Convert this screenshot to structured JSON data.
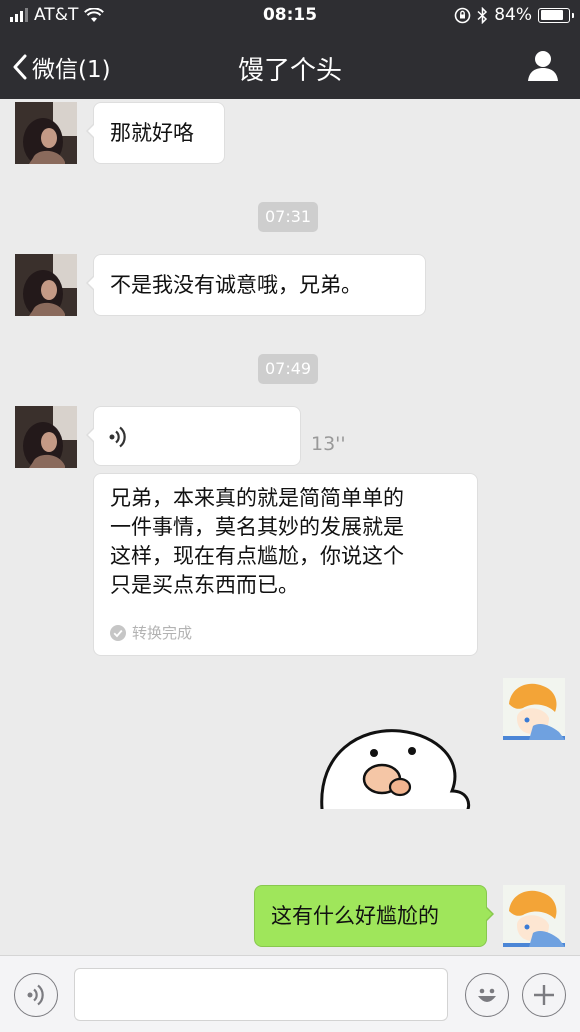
{
  "status_bar": {
    "carrier": "AT&T",
    "time": "08:15",
    "battery": "84%"
  },
  "nav": {
    "back_label": "微信(1)",
    "title": "馒了个头"
  },
  "chat": {
    "msg1": "那就好咯",
    "time1": "07:31",
    "msg2": "不是我没有诚意哦，兄弟。",
    "time2": "07:49",
    "voice_duration": "13''",
    "transcript_lines": [
      "兄弟，本来真的就是简简单单的",
      "一件事情，莫名其妙的发展就是",
      "这样，现在有点尴尬，你说这个",
      "只是买点东西而已。"
    ],
    "transcript_status": "转换完成",
    "my_reply": "这有什么好尴尬的"
  },
  "colors": {
    "nav_bg": "#2e2e32",
    "chat_bg": "#ebebeb",
    "my_bubble": "#9fe65b"
  },
  "icons": [
    "back-chevron-icon",
    "profile-icon",
    "voice-wave-icon",
    "check-circle-icon",
    "voice-mode-icon",
    "emoji-icon",
    "plus-icon"
  ]
}
